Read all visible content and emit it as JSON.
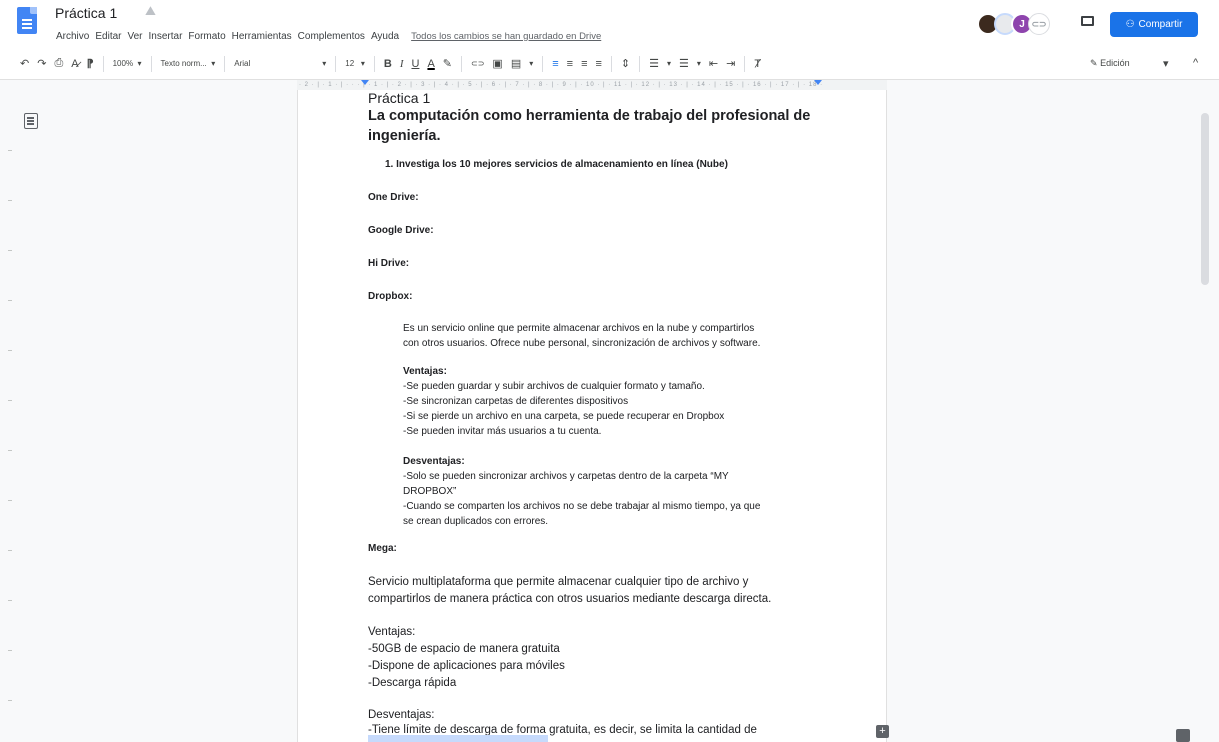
{
  "app": {
    "title": "Práctica 1",
    "star_icon": "☆",
    "drive_icon": "⛰",
    "menu": [
      "Archivo",
      "Editar",
      "Ver",
      "Insertar",
      "Formato",
      "Herramientas",
      "Complementos",
      "Ayuda"
    ],
    "save_status": "Todos los cambios se han guardado en Drive",
    "share_label": "Compartir",
    "avatar_letter": "J",
    "edit_mode_label": "Edición"
  },
  "toolbar": {
    "zoom": "100%",
    "style": "Texto norm...",
    "font": "Arial",
    "font_size": "12"
  },
  "ruler": {
    "ticks": "· 2 · | · 1 · | · · · | · 1 · | · 2 · | · 3 · | · 4 · | · 5 · | · 6 · | · 7 · | · 8 · | · 9 · | · 10 · | · 11 · | · 12 · | · 13 · | · 14 · | · 15 · | · 16 · | · 17 · | · 18 ·"
  },
  "doc": {
    "top_title": "Práctica 1",
    "main_title_1": "La computación como herramienta de trabajo del profesional de",
    "main_title_2": "ingeniería.",
    "item_1": "1.  Investiga los 10 mejores servicios de almacenamiento en línea (Nube)",
    "onedrive": "One Drive:",
    "gdrive": "Google Drive:",
    "hidrive": "Hi Drive:",
    "dropbox": "Dropbox:",
    "dropbox_desc_1": "Es un servicio online que permite almacenar archivos en la nube y compartirlos",
    "dropbox_desc_2": "con otros usuarios. Ofrece nube personal, sincronización de archivos y software.",
    "ventajas_label": "Ventajas:",
    "dropbox_v1": "-Se pueden guardar y subir archivos de cualquier formato y tamaño.",
    "dropbox_v2": "-Se sincronizan carpetas de diferentes dispositivos",
    "dropbox_v3": "-Si se pierde un archivo en una carpeta, se puede recuperar en Dropbox",
    "dropbox_v4": "-Se pueden invitar más usuarios a tu cuenta.",
    "desventajas_label": "Desventajas:",
    "dropbox_d1": "-Solo se pueden sincronizar archivos y carpetas dentro de la carpeta “MY",
    "dropbox_d1b": "DROPBOX”",
    "dropbox_d2": "-Cuando se comparten los archivos no se debe trabajar al mismo tiempo, ya que",
    "dropbox_d2b": "se crean duplicados con errores.",
    "mega": "Mega:",
    "mega_desc_1": "Servicio multiplataforma que permite almacenar cualquier tipo de archivo y",
    "mega_desc_2": "compartirlos de manera práctica con otros usuarios mediante descarga directa.",
    "mega_v_label": "Ventajas:",
    "mega_v1": "-50GB de espacio de manera gratuita",
    "mega_v2": "-Dispone de aplicaciones para móviles",
    "mega_v3": "-Descarga rápida",
    "mega_d_label": "Desventajas:",
    "mega_d1": "-Tiene límite de descarga de forma gratuita, es decir, se limita la cantidad de"
  },
  "colors": {
    "brand_blue": "#1a73e8",
    "doc_icon_blue": "#4285f4",
    "red_heading": "#d93025"
  },
  "icons": {
    "undo": "↶",
    "redo": "↷",
    "print": "⎙",
    "spellcheck": "A̷",
    "paint_format": "⁋",
    "dropdown": "▾",
    "link": "⊂⊃",
    "comment_add": "▣",
    "image": "▤",
    "align_left": "≡",
    "align_center": "≡",
    "align_right": "≡",
    "align_justify": "≡",
    "line_spacing": "⇕",
    "checklist": "☰",
    "bullets": "☰",
    "numbered": "☰",
    "indent_less": "⇤",
    "indent_more": "⇥",
    "clear_format": "Ⱦ",
    "pencil": "✎",
    "collapse": "^",
    "plus": "+"
  }
}
